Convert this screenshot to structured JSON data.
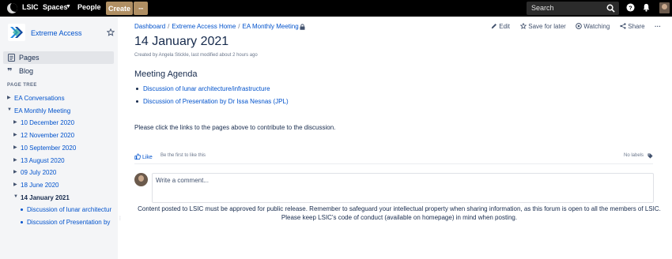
{
  "topnav": {
    "brand": "LSIC",
    "spaces_label": "Spaces",
    "people_label": "People",
    "create_label": "Create",
    "more_label": "···",
    "search_placeholder": "Search"
  },
  "sidebar": {
    "space_name": "Extreme Access",
    "pages_label": "Pages",
    "blog_label": "Blog",
    "page_tree_heading": "PAGE TREE",
    "tree": [
      {
        "label": "EA Conversations",
        "level": 0,
        "state": "collapsed"
      },
      {
        "label": "EA Monthly Meeting",
        "level": 0,
        "state": "expanded"
      },
      {
        "label": "10 December 2020",
        "level": 1,
        "state": "collapsed"
      },
      {
        "label": "12 November 2020",
        "level": 1,
        "state": "collapsed"
      },
      {
        "label": "10 September 2020",
        "level": 1,
        "state": "collapsed"
      },
      {
        "label": "13 August 2020",
        "level": 1,
        "state": "collapsed"
      },
      {
        "label": "09 July 2020",
        "level": 1,
        "state": "collapsed"
      },
      {
        "label": "18 June 2020",
        "level": 1,
        "state": "collapsed"
      },
      {
        "label": "14 January 2021",
        "level": 1,
        "state": "expanded",
        "current": true
      },
      {
        "label": "Discussion of lunar architectur",
        "level": 2,
        "state": "leaf"
      },
      {
        "label": "Discussion of Presentation by",
        "level": 2,
        "state": "leaf"
      }
    ]
  },
  "breadcrumb": [
    "Dashboard",
    "Extreme Access Home",
    "EA Monthly Meeting"
  ],
  "actions": {
    "edit": "Edit",
    "save_for_later": "Save for later",
    "watching": "Watching",
    "share": "Share",
    "more": "···"
  },
  "page": {
    "title": "14 January 2021",
    "byline": "Created by Angela Stickle, last modified about 2 hours ago",
    "agenda_heading": "Meeting Agenda",
    "agenda_items": [
      "Discussion of lunar architecture/infrastructure",
      "Discussion of Presentation by Dr Issa Nesnas (JPL)"
    ],
    "instructions": "Please click the links to the pages above to contribute to the discussion."
  },
  "footer": {
    "like_label": "Like",
    "like_first": "Be the first to like this",
    "no_labels": "No labels",
    "comment_placeholder": "Write a comment...",
    "notice": "Content posted to LSIC must be approved for public release. Remember to safeguard your intellectual property when sharing information, as this forum is open to all the members of LSIC. Please keep LSIC's code of conduct (available on homepage) in mind when posting."
  },
  "colors": {
    "link": "#0052cc",
    "text": "#172b4d",
    "nav_bg": "#000000",
    "create_button": "#b08f63",
    "sidebar_bg": "#f4f5f7"
  }
}
